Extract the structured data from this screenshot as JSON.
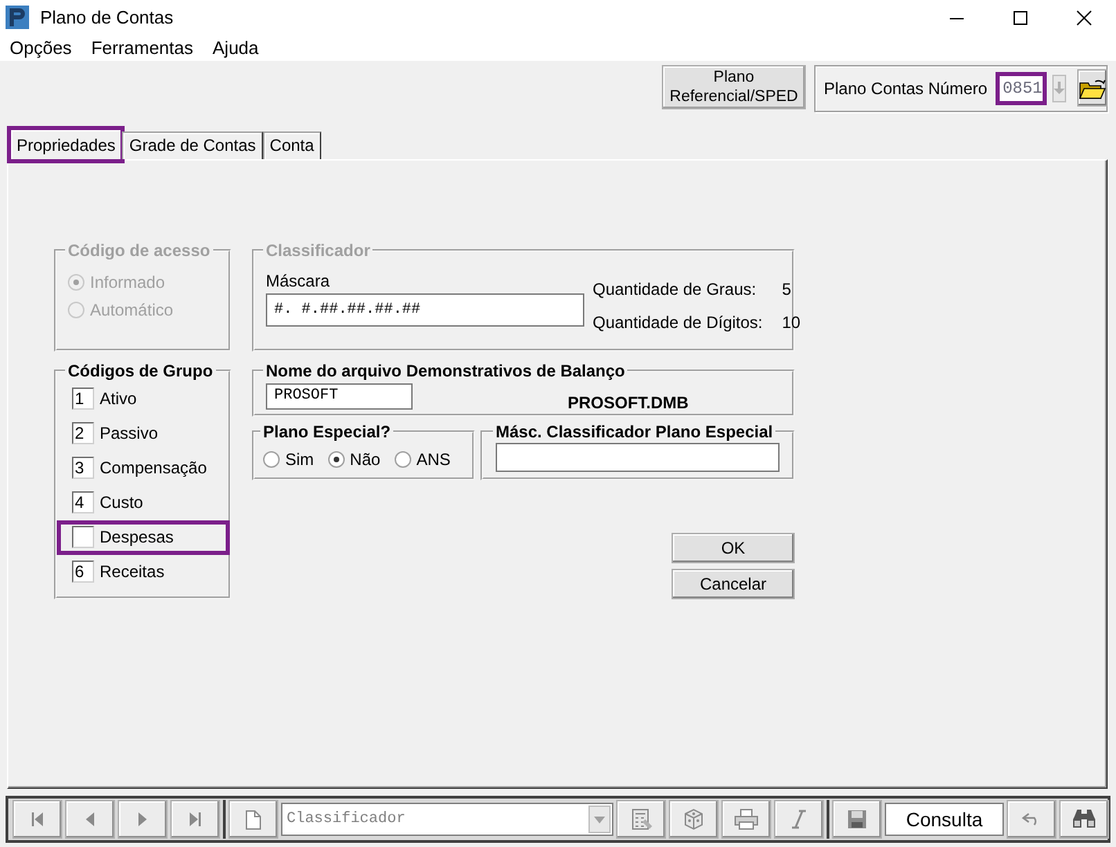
{
  "window": {
    "title": "Plano de Contas"
  },
  "menu": [
    "Opções",
    "Ferramentas",
    "Ajuda"
  ],
  "referencial_button": "Plano Referencial/SPED",
  "plan_number": {
    "label": "Plano Contas Número",
    "value": "0851",
    "highlighted": true
  },
  "tabs": [
    {
      "label": "Propriedades",
      "selected": true,
      "highlighted": true
    },
    {
      "label": "Grade de Contas",
      "selected": false,
      "highlighted": false
    },
    {
      "label": "Conta",
      "selected": false,
      "highlighted": false
    }
  ],
  "access_code": {
    "title": "Código de acesso",
    "disabled": true,
    "options": [
      {
        "label": "Informado",
        "selected": true
      },
      {
        "label": "Automático",
        "selected": false
      }
    ]
  },
  "classifier": {
    "title": "Classificador",
    "disabled": true,
    "mask_label": "Máscara",
    "mask": "#. #.##.##.##.##",
    "stats": [
      {
        "label": "Quantidade de Graus:",
        "value": "5"
      },
      {
        "label": "Quantidade de Dígitos:",
        "value": "10"
      }
    ]
  },
  "group_codes": {
    "title": "Códigos de Grupo",
    "items": [
      {
        "code": "1",
        "label": "Ativo",
        "highlighted": false
      },
      {
        "code": "2",
        "label": "Passivo",
        "highlighted": false
      },
      {
        "code": "3",
        "label": "Compensação",
        "highlighted": false
      },
      {
        "code": "4",
        "label": "Custo",
        "highlighted": false
      },
      {
        "label": "Despesas",
        "highlighted": true
      },
      {
        "code": "6",
        "label": "Receitas",
        "highlighted": false
      }
    ]
  },
  "balance_file": {
    "title": "Nome do arquivo Demonstrativos de Balanço",
    "value": "PROSOFT",
    "file": "PROSOFT.DMB"
  },
  "special_plan": {
    "title": "Plano Especial?",
    "options": [
      {
        "label": "Sim",
        "selected": false
      },
      {
        "label": "Não",
        "selected": true
      },
      {
        "label": "ANS",
        "selected": false
      }
    ]
  },
  "special_mask": {
    "title": "Másc. Classificador Plano Especial"
  },
  "buttons": [
    "OK",
    "Cancelar"
  ],
  "navigator": {
    "combo": "Classificador",
    "mode": "Consulta"
  }
}
